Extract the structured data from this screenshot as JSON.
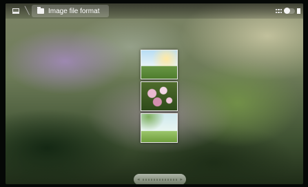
{
  "header": {
    "breadcrumb": {
      "current": "Image file format"
    },
    "icons": {
      "home": "home-icon",
      "separator": "chevron-right-icon",
      "folder": "folder-icon",
      "grid": "grid-view-icon",
      "list": "list-view-icon"
    }
  },
  "gallery": {
    "thumbnails": [
      {
        "subject": "sky-and-grass"
      },
      {
        "subject": "pink-flowers"
      },
      {
        "subject": "meadow-landscape"
      }
    ]
  },
  "scroll": {
    "left_arrow": "◂",
    "right_arrow": "▸"
  }
}
